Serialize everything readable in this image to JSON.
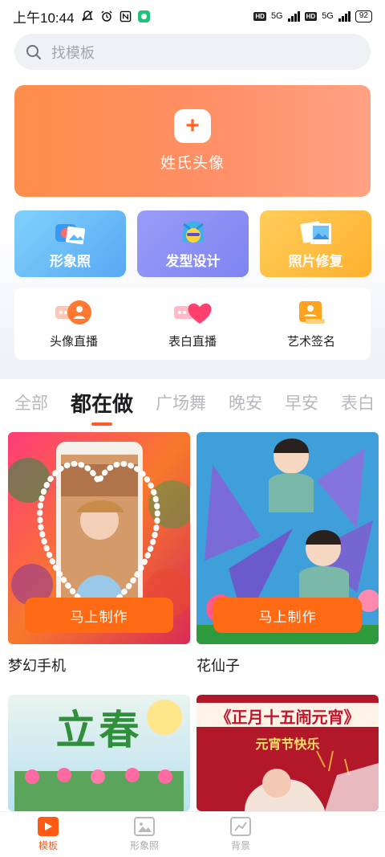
{
  "status_bar": {
    "time": "上午10:44",
    "network1": "5G",
    "network2": "5G",
    "battery": "92"
  },
  "search": {
    "placeholder": "找模板"
  },
  "hero": {
    "label": "姓氏头像",
    "icon": "plus-icon"
  },
  "feature_cards": [
    {
      "label": "形象照",
      "icon": "photo-camera-icon"
    },
    {
      "label": "发型设计",
      "icon": "hairstyle-avatar-icon"
    },
    {
      "label": "照片修复",
      "icon": "photo-frame-icon"
    }
  ],
  "quick_actions": [
    {
      "label": "头像直播",
      "icon": "avatar-live-icon"
    },
    {
      "label": "表白直播",
      "icon": "heart-live-icon"
    },
    {
      "label": "艺术签名",
      "icon": "signature-icon"
    }
  ],
  "category_tabs": [
    "全部",
    "都在做",
    "广场舞",
    "晚安",
    "早安",
    "表白"
  ],
  "active_tab": "都在做",
  "templates": [
    {
      "title": "梦幻手机",
      "button": "马上制作"
    },
    {
      "title": "花仙子",
      "button": "马上制作"
    },
    {
      "title": "",
      "overlay_text": "立春"
    },
    {
      "title": "",
      "overlay_text": "《正月十五闹元宵》",
      "sub_text": "元宵节快乐"
    }
  ],
  "bottom_nav": [
    {
      "label": "模板",
      "active": true
    },
    {
      "label": "形象照",
      "active": false
    },
    {
      "label": "背景",
      "active": false
    }
  ],
  "colors": {
    "accent": "#ff6a14",
    "active_tab_underline": "#ff5a2a"
  }
}
